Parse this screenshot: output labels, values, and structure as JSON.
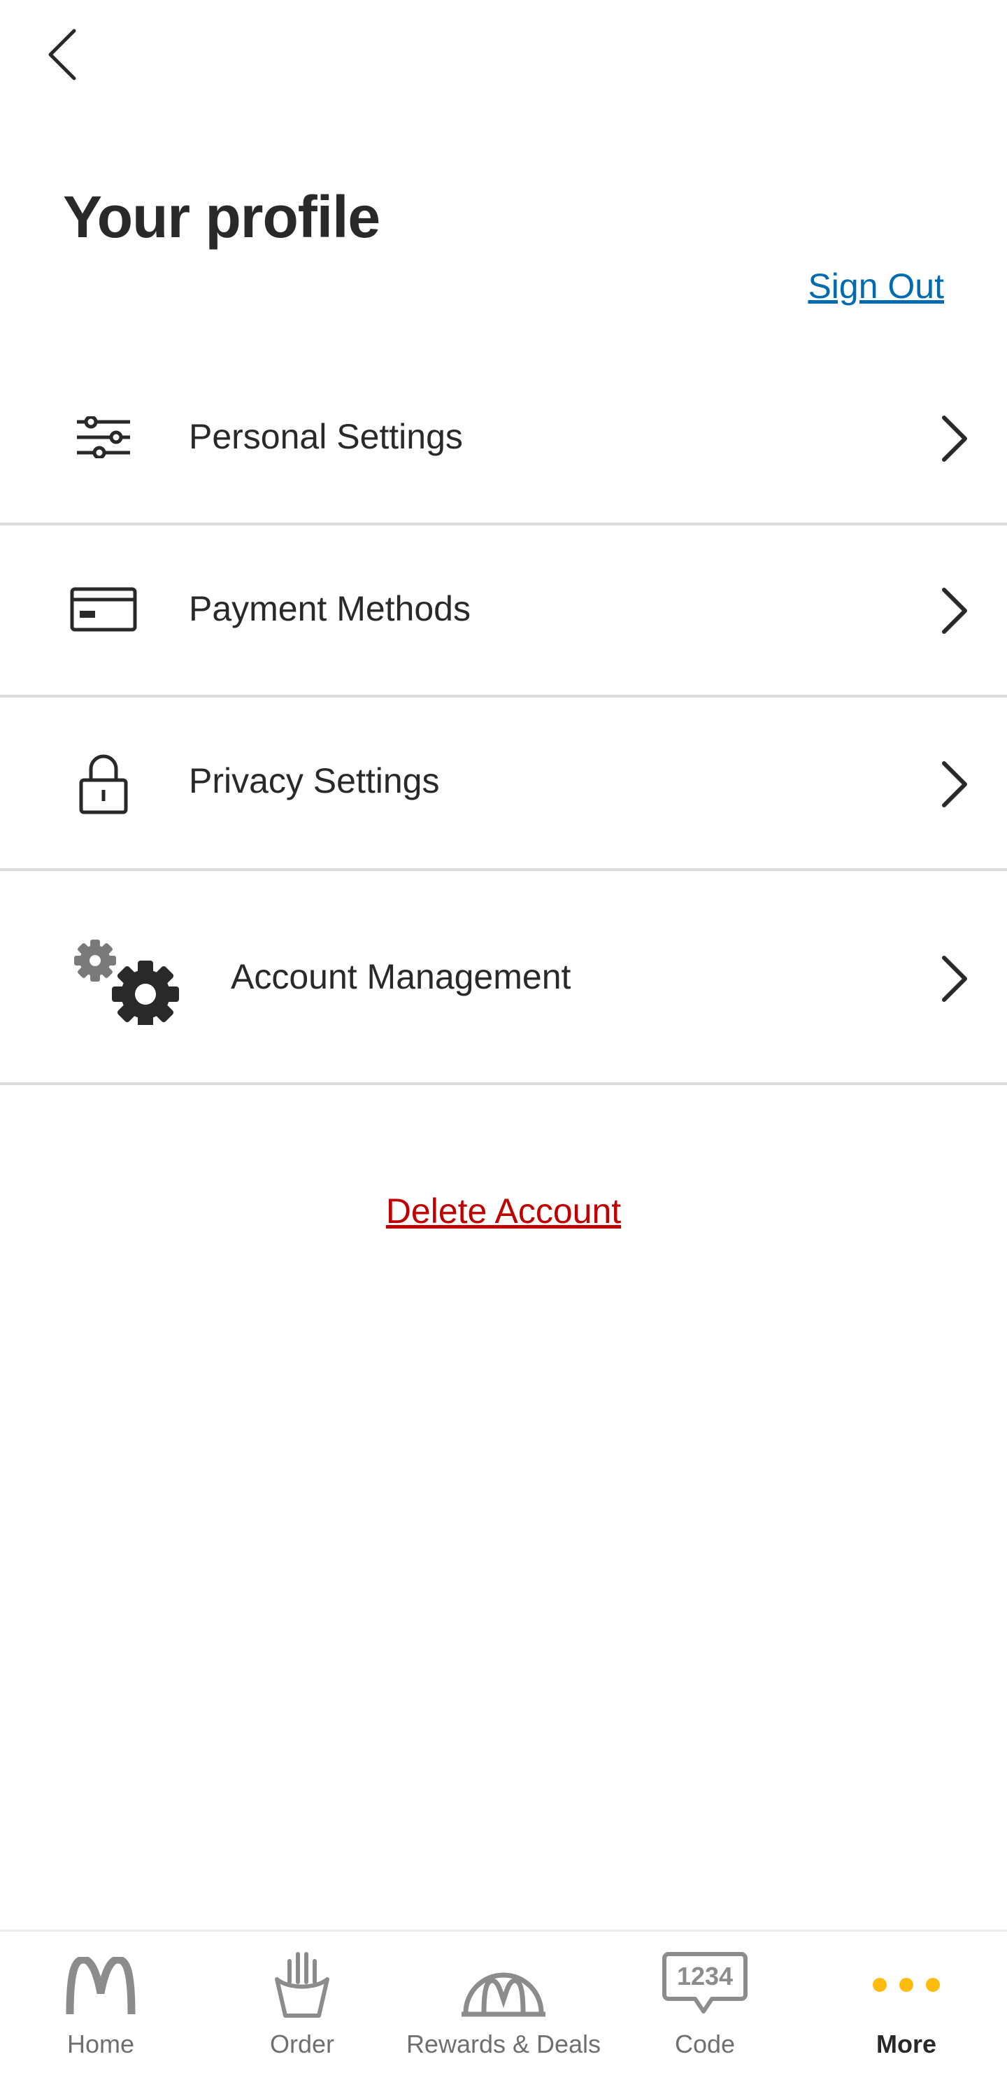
{
  "header": {
    "title": "Your profile",
    "sign_out_label": "Sign Out"
  },
  "menu": [
    {
      "label": "Personal Settings",
      "icon": "sliders-icon"
    },
    {
      "label": "Payment Methods",
      "icon": "credit-card-icon"
    },
    {
      "label": "Privacy Settings",
      "icon": "lock-icon"
    },
    {
      "label": "Account Management",
      "icon": "gears-icon"
    }
  ],
  "delete_label": "Delete Account",
  "tabs": [
    {
      "label": "Home",
      "icon": "golden-arches-icon"
    },
    {
      "label": "Order",
      "icon": "fries-icon"
    },
    {
      "label": "Rewards & Deals",
      "icon": "rewards-arch-icon"
    },
    {
      "label": "Code",
      "icon": "code-bubble-icon",
      "icon_text": "1234"
    },
    {
      "label": "More",
      "icon": "more-dots-icon",
      "active": true
    }
  ],
  "colors": {
    "link": "#006bae",
    "danger": "#c00000",
    "accent": "#ffbc0d",
    "text": "#292929"
  }
}
